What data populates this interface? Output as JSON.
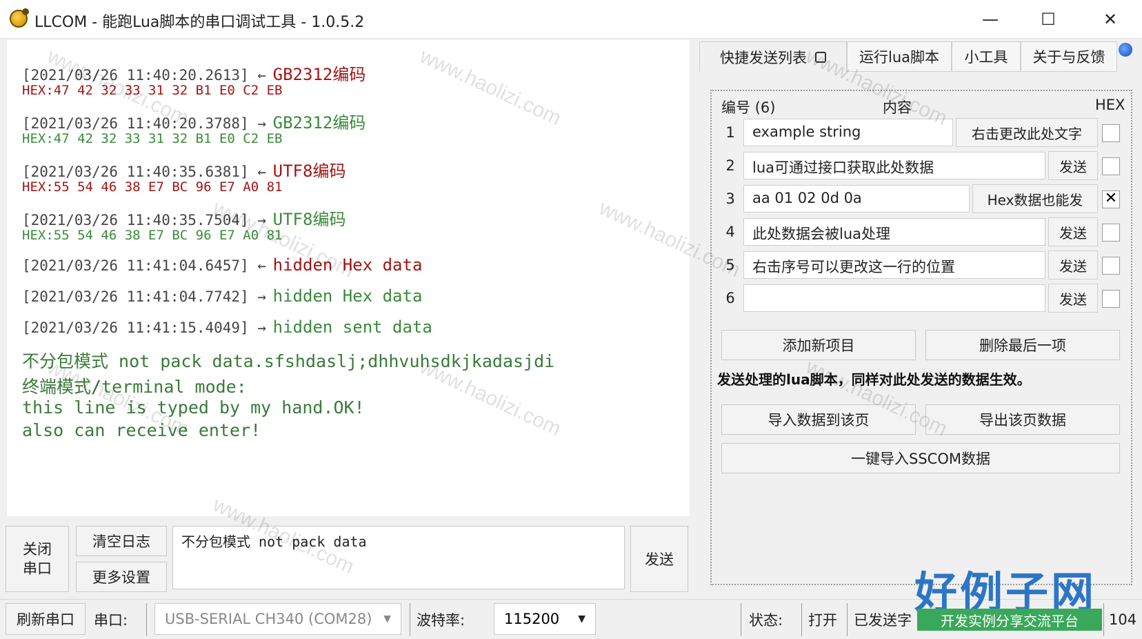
{
  "window": {
    "title": "LLCOM - 能跑Lua脚本的串口调试工具 - 1.0.5.2",
    "minimize": "—",
    "maximize": "☐",
    "close": "✕"
  },
  "log": [
    {
      "ts": "[2021/03/26 11:40:20.2613] ←",
      "msg": "GB2312编码",
      "dir": "recv",
      "hex": "HEX:47 42 32 33 31 32 B1 E0 C2 EB"
    },
    {
      "ts": "[2021/03/26 11:40:20.3788] →",
      "msg": "GB2312编码",
      "dir": "sent",
      "hex": "HEX:47 42 32 33 31 32 B1 E0 C2 EB"
    },
    {
      "ts": "[2021/03/26 11:40:35.6381] ←",
      "msg": "UTF8编码",
      "dir": "recv",
      "hex": "HEX:55 54 46 38 E7 BC 96 E7 A0 81"
    },
    {
      "ts": "[2021/03/26 11:40:35.7504] →",
      "msg": "UTF8编码",
      "dir": "sent",
      "hex": "HEX:55 54 46 38 E7 BC 96 E7 A0 81"
    },
    {
      "ts": "[2021/03/26 11:41:04.6457] ←",
      "msg": "hidden Hex data",
      "dir": "recv"
    },
    {
      "ts": "[2021/03/26 11:41:04.7742] →",
      "msg": "hidden Hex data",
      "dir": "sent"
    },
    {
      "ts": "[2021/03/26 11:41:15.4049] →",
      "msg": "hidden sent data",
      "dir": "sent"
    }
  ],
  "terminal_lines": [
    "不分包模式 not pack data.sfshdaslj;dhhvuhsdkjkadasjdi",
    "终端模式/terminal mode:",
    "this line is typed by my hand.OK!",
    "also can receive enter!"
  ],
  "bottom": {
    "close_port": "关闭\n串口",
    "clear_log": "清空日志",
    "more_settings": "更多设置",
    "send_input": "不分包模式 not pack data",
    "send": "发送"
  },
  "tabs": [
    "快捷发送列表",
    "运行lua脚本",
    "小工具",
    "关于与反馈"
  ],
  "quick_list": {
    "header_num": "编号 (6)",
    "header_content": "内容",
    "header_hex": "HEX",
    "rows": [
      {
        "num": "1",
        "text": "example string",
        "btn": "右击更改此处文字",
        "hex": ""
      },
      {
        "num": "2",
        "text": "lua可通过接口获取此处数据",
        "btn": "发送",
        "hex": ""
      },
      {
        "num": "3",
        "text": "aa 01 02 0d 0a",
        "btn": "Hex数据也能发",
        "hex": "✕"
      },
      {
        "num": "4",
        "text": "此处数据会被lua处理",
        "btn": "发送",
        "hex": ""
      },
      {
        "num": "5",
        "text": "右击序号可以更改这一行的位置",
        "btn": "发送",
        "hex": ""
      },
      {
        "num": "6",
        "text": "",
        "btn": "发送",
        "hex": ""
      }
    ],
    "add_item": "添加新项目",
    "delete_last": "删除最后一项",
    "note": "发送处理的lua脚本，同样对此处发送的数据生效。",
    "import_page": "导入数据到该页",
    "export_page": "导出该页数据",
    "import_sscom": "一键导入SSCOM数据"
  },
  "status": {
    "refresh_port": "刷新串口",
    "port_label": "串口:",
    "port_value": "USB-SERIAL CH340 (COM28)",
    "baud_label": "波特率:",
    "baud_value": "115200",
    "state_label": "状态:",
    "state_value": "打开",
    "sent_label": "已发送字",
    "count": "104"
  },
  "watermark": {
    "site": "www.haolizi.com",
    "brand": "好例子网",
    "brand_sub": "开发实例分享交流平台"
  },
  "colors": {
    "recv": "#a31515",
    "sent": "#3a8a3a",
    "accent": "#2d75c5"
  }
}
